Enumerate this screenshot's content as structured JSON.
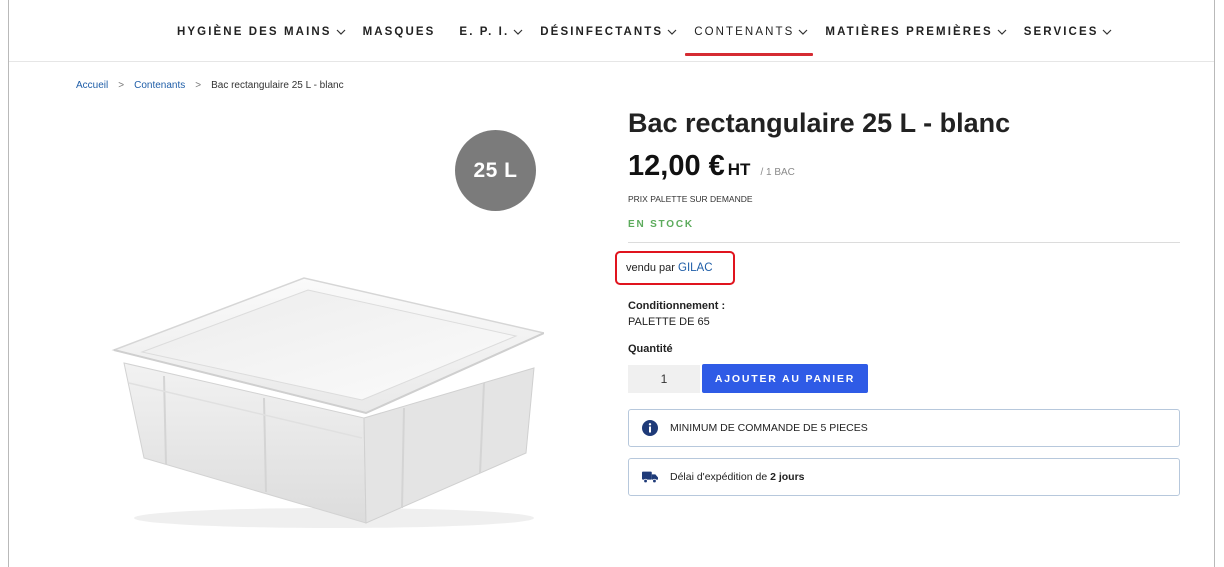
{
  "nav": {
    "items": [
      {
        "label": "HYGIÈNE DES MAINS",
        "has_chevron": true
      },
      {
        "label": "MASQUES",
        "has_chevron": false
      },
      {
        "label": "E. P. I.",
        "has_chevron": true
      },
      {
        "label": "DÉSINFECTANTS",
        "has_chevron": true
      },
      {
        "label": "CONTENANTS",
        "has_chevron": true,
        "active": true
      },
      {
        "label": "MATIÈRES PREMIÈRES",
        "has_chevron": true
      },
      {
        "label": "SERVICES",
        "has_chevron": true
      }
    ],
    "active_color": "#d52b32"
  },
  "breadcrumb": {
    "home": "Accueil",
    "category": "Contenants",
    "current": "Bac rectangulaire 25 L - blanc"
  },
  "product": {
    "badge": "25 L",
    "title": "Bac rectangulaire 25 L - blanc",
    "price": "12,00 €",
    "price_suffix": "HT",
    "price_unit": "/ 1 BAC",
    "palette_note": "PRIX PALETTE SUR DEMANDE",
    "stock": "EN STOCK",
    "seller_prefix": "vendu par",
    "seller_name": "GILAC",
    "cond_label": "Conditionnement :",
    "cond_value": "PALETTE DE 65",
    "qty_label": "Quantité",
    "qty_value": "1",
    "add_button": "AJOUTER AU PANIER",
    "min_order": "MINIMUM DE COMMANDE DE 5 PIECES",
    "shipping_prefix": "Délai d'expédition de",
    "shipping_days": "2 jours"
  },
  "icons": {
    "chevron": "chevron-down-icon",
    "separator": "chevron-right-icon",
    "info": "info-icon",
    "truck": "truck-icon"
  },
  "colors": {
    "accent": "#2f5be6",
    "stock_green": "#5cab5c",
    "highlight_red": "#e0141e",
    "link_blue": "#1f5ea8"
  }
}
